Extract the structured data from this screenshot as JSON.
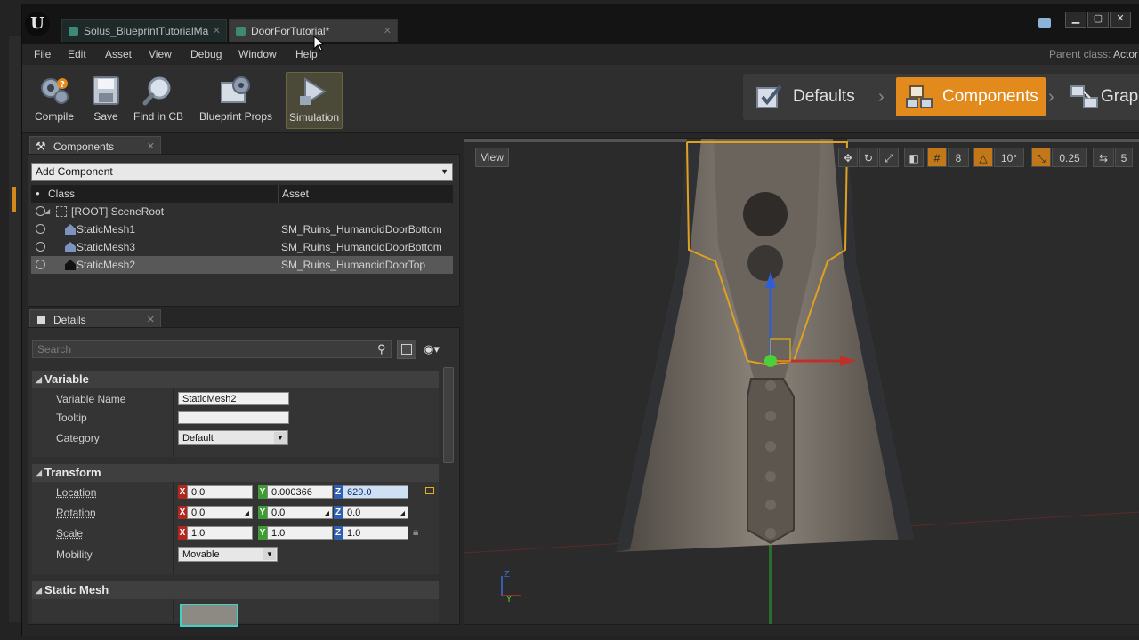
{
  "tabs": [
    {
      "label": "Solus_BlueprintTutorialMa",
      "active": false
    },
    {
      "label": "DoorForTutorial*",
      "active": true
    }
  ],
  "menu": [
    "File",
    "Edit",
    "Asset",
    "View",
    "Debug",
    "Window",
    "Help"
  ],
  "parent_class": {
    "label": "Parent class:",
    "value": "Actor"
  },
  "toolbar": {
    "compile": "Compile",
    "save": "Save",
    "find": "Find in CB",
    "blueprint_props": "Blueprint Props",
    "simulation": "Simulation"
  },
  "modes": {
    "defaults": "Defaults",
    "components": "Components",
    "graph": "Graph"
  },
  "components_panel": {
    "title": "Components",
    "add_component": "Add Component",
    "col_class": "Class",
    "col_asset": "Asset",
    "rows": [
      {
        "class": "[ROOT] SceneRoot",
        "asset": ""
      },
      {
        "class": "StaticMesh1",
        "asset": "SM_Ruins_HumanoidDoorBottom"
      },
      {
        "class": "StaticMesh3",
        "asset": "SM_Ruins_HumanoidDoorBottom"
      },
      {
        "class": "StaticMesh2",
        "asset": "SM_Ruins_HumanoidDoorTop"
      }
    ]
  },
  "details_panel": {
    "title": "Details",
    "search_placeholder": "Search",
    "variable": {
      "header": "Variable",
      "name_label": "Variable Name",
      "name_value": "StaticMesh2",
      "tooltip_label": "Tooltip",
      "tooltip_value": "",
      "category_label": "Category",
      "category_value": "Default"
    },
    "transform": {
      "header": "Transform",
      "location_label": "Location",
      "location": {
        "x": "0.0",
        "y": "0.000366",
        "z": "629.0"
      },
      "rotation_label": "Rotation",
      "rotation": {
        "x": "0.0",
        "y": "0.0",
        "z": "0.0"
      },
      "scale_label": "Scale",
      "scale": {
        "x": "1.0",
        "y": "1.0",
        "z": "1.0"
      },
      "mobility_label": "Mobility",
      "mobility_value": "Movable"
    },
    "static_mesh": {
      "header": "Static Mesh"
    }
  },
  "viewport": {
    "view_label": "View",
    "grid_snap": "8",
    "rot_snap": "10°",
    "scale_snap": "0.25",
    "camera_speed": "5",
    "axis_z": "Z",
    "axis_y": "Y"
  },
  "colors": {
    "accent": "#e28a1c",
    "axis_x": "#b3261e",
    "axis_y": "#3f9c35",
    "axis_z": "#2f5fb3"
  }
}
